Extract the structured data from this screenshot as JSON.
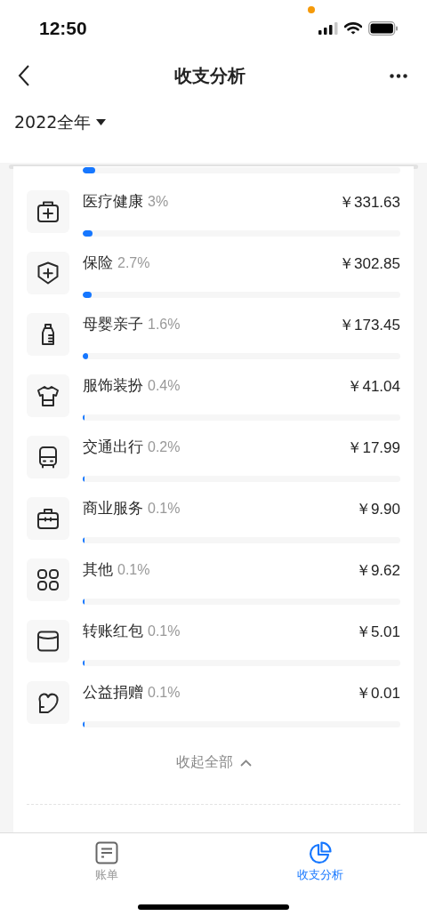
{
  "status_bar": {
    "time": "12:50"
  },
  "nav": {
    "title": "收支分析"
  },
  "period": {
    "label": "2022全年"
  },
  "clipped_bar": {
    "level": 0.04
  },
  "categories": [
    {
      "name": "医疗健康",
      "share": "3%",
      "amount": "￥331.63",
      "level": 0.03
    },
    {
      "name": "保险",
      "share": "2.7%",
      "amount": "￥302.85",
      "level": 0.027
    },
    {
      "name": "母婴亲子",
      "share": "1.6%",
      "amount": "￥173.45",
      "level": 0.016
    },
    {
      "name": "服饰装扮",
      "share": "0.4%",
      "amount": "￥41.04",
      "level": 0.004
    },
    {
      "name": "交通出行",
      "share": "0.2%",
      "amount": "￥17.99",
      "level": 0.002
    },
    {
      "name": "商业服务",
      "share": "0.1%",
      "amount": "￥9.90",
      "level": 0.001
    },
    {
      "name": "其他",
      "share": "0.1%",
      "amount": "￥9.62",
      "level": 0.001
    },
    {
      "name": "转账红包",
      "share": "0.1%",
      "amount": "￥5.01",
      "level": 0.001
    },
    {
      "name": "公益捐赠",
      "share": "0.1%",
      "amount": "￥0.01",
      "level": 0.001
    }
  ],
  "collapse_link": {
    "label": "收起全部"
  },
  "tabs": [
    {
      "label": "账单",
      "selected": false
    },
    {
      "label": "收支分析",
      "selected": true
    }
  ]
}
